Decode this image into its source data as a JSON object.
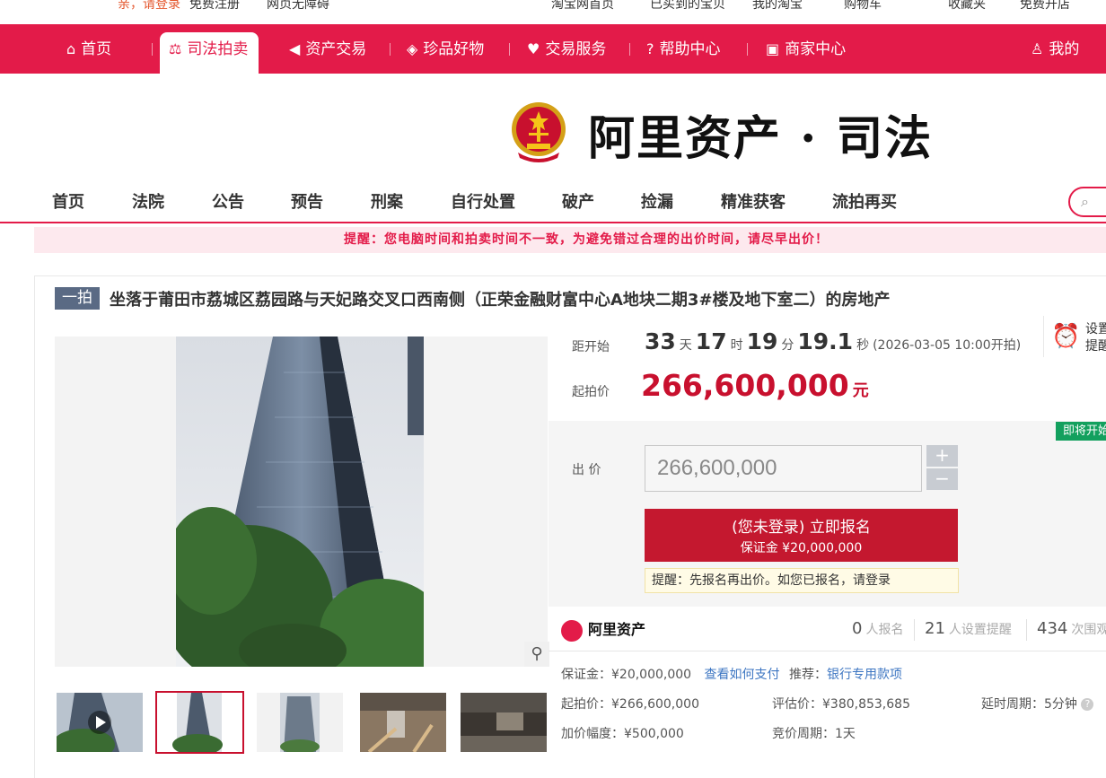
{
  "topbar": {
    "greeting": "亲，请登录",
    "register": "免费注册",
    "accessible": "网页无障碍",
    "taobao_home": "淘宝网首页",
    "bought": "已买到的宝贝",
    "my_taobao": "我的淘宝",
    "cart": "购物车",
    "favorites": "收藏夹",
    "open_shop": "免费开店"
  },
  "nav": {
    "items": [
      {
        "label": "首页",
        "icon": "home-icon"
      },
      {
        "label": "司法拍卖",
        "icon": "court-emblem-icon"
      },
      {
        "label": "资产交易",
        "icon": "asset-icon"
      },
      {
        "label": "珍品好物",
        "icon": "gem-icon"
      },
      {
        "label": "交易服务",
        "icon": "heart-icon"
      },
      {
        "label": "帮助中心",
        "icon": "help-icon"
      },
      {
        "label": "商家中心",
        "icon": "store-icon"
      }
    ],
    "my": "我的"
  },
  "logo": {
    "text": "阿里资产 · 司法"
  },
  "subnav": {
    "items": [
      "首页",
      "法院",
      "公告",
      "预告",
      "刑案",
      "自行处置",
      "破产",
      "捡漏",
      "精准获客",
      "流拍再买"
    ]
  },
  "alert": "提醒：您电脑时间和拍卖时间不一致，为避免错过合理的出价时间，请尽早出价！",
  "item": {
    "round": "一拍",
    "title": "坐落于莆田市荔城区荔园路与天妃路交叉口西南侧（正荣金融财富中心A地块二期3#楼及地下室二）的房地产"
  },
  "countdown": {
    "label": "距开始",
    "days": "33",
    "days_unit": "天",
    "hours": "17",
    "hours_unit": "时",
    "minutes": "19",
    "minutes_unit": "分",
    "seconds": "19.1",
    "seconds_unit": "秒",
    "start_time": "(2026-03-05 10:00开拍)"
  },
  "reminder": {
    "line1": "设置",
    "line2": "提醒"
  },
  "start_price": {
    "label": "起拍价",
    "value": "266,600,000",
    "unit": "元"
  },
  "bid": {
    "status_badge": "即将开始",
    "label": "出 价",
    "input_value": "266,600,000",
    "plus": "+",
    "minus": "−",
    "signup_line1": "(您未登录) 立即报名",
    "signup_line2": "保证金 ¥20,000,000",
    "tip": "提醒：先报名再出价。如您已报名，请登录"
  },
  "stats": {
    "brand": "阿里资产",
    "signups": "0",
    "signups_label": "人报名",
    "reminders": "21",
    "reminders_label": "人设置提醒",
    "views": "434",
    "views_label": "次围观"
  },
  "details": {
    "deposit": "保证金：¥20,000,000",
    "how_to_pay": "查看如何支付",
    "recommend": "推荐：",
    "bank_account": "银行专用款项",
    "start_price": "起拍价：¥266,600,000",
    "appraisal": "评估价：¥380,853,685",
    "delay": "延时周期：5分钟",
    "increment": "加价幅度：¥500,000",
    "period": "竞价周期：1天"
  },
  "colors": {
    "brand_red": "#e31b49",
    "price_red": "#c8102e",
    "signup_red": "#c4182f",
    "soon_green": "#13a05e",
    "badge_slate": "#5a6a84"
  }
}
